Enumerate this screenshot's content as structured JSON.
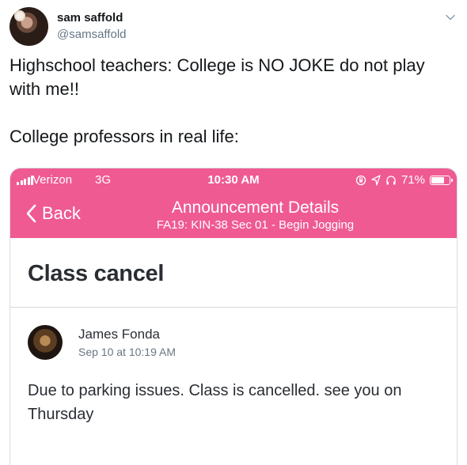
{
  "tweet": {
    "display_name": "sam saffold",
    "handle": "@samsaffold",
    "text_line1": "Highschool teachers: College is NO JOKE do not play with me!!",
    "text_line2": "College professors in real life:"
  },
  "phone": {
    "status": {
      "carrier": "Verizon",
      "network": "3G",
      "time": "10:30 AM",
      "battery": "71%",
      "battery_level": 0.71
    },
    "nav": {
      "back_label": "Back",
      "title": "Announcement Details",
      "subtitle": "FA19: KIN-38 Sec 01 - Begin Jogging"
    },
    "announcement": {
      "title": "Class cancel",
      "author": "James Fonda",
      "date": "Sep 10 at 10:19 AM",
      "body": "Due to parking issues.  Class is cancelled. see you on Thursday"
    }
  },
  "colors": {
    "accent_pink": "#ef5a93",
    "text_dark": "#14171a",
    "text_gray": "#657786"
  }
}
